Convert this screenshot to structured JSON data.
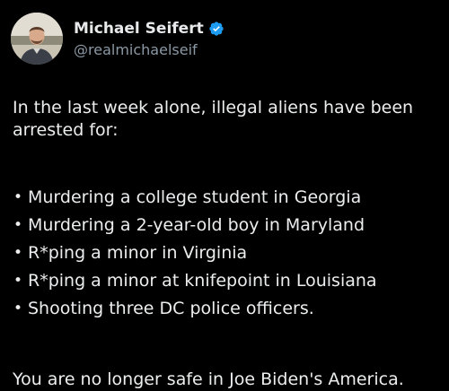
{
  "author": {
    "display_name": "Michael Seifert",
    "handle": "@realmichaelseif",
    "verified": true,
    "verified_icon": "verified-badge-icon",
    "accent_color": "#1d9bf0"
  },
  "tweet": {
    "intro": "In the last week alone, illegal aliens have been arrested for:",
    "bullet_glyph": "•",
    "items": [
      "Murdering a college student in Georgia",
      "Murdering a 2-year-old boy in Maryland",
      "R*ping a minor in Virginia",
      "R*ping a minor at knifepoint in Louisiana",
      "Shooting three DC police officers."
    ],
    "closing": "You are no longer safe in Joe Biden's America."
  },
  "theme": {
    "background": "#000000",
    "text": "#e7e9ea",
    "secondary_text": "#8b98a5"
  }
}
